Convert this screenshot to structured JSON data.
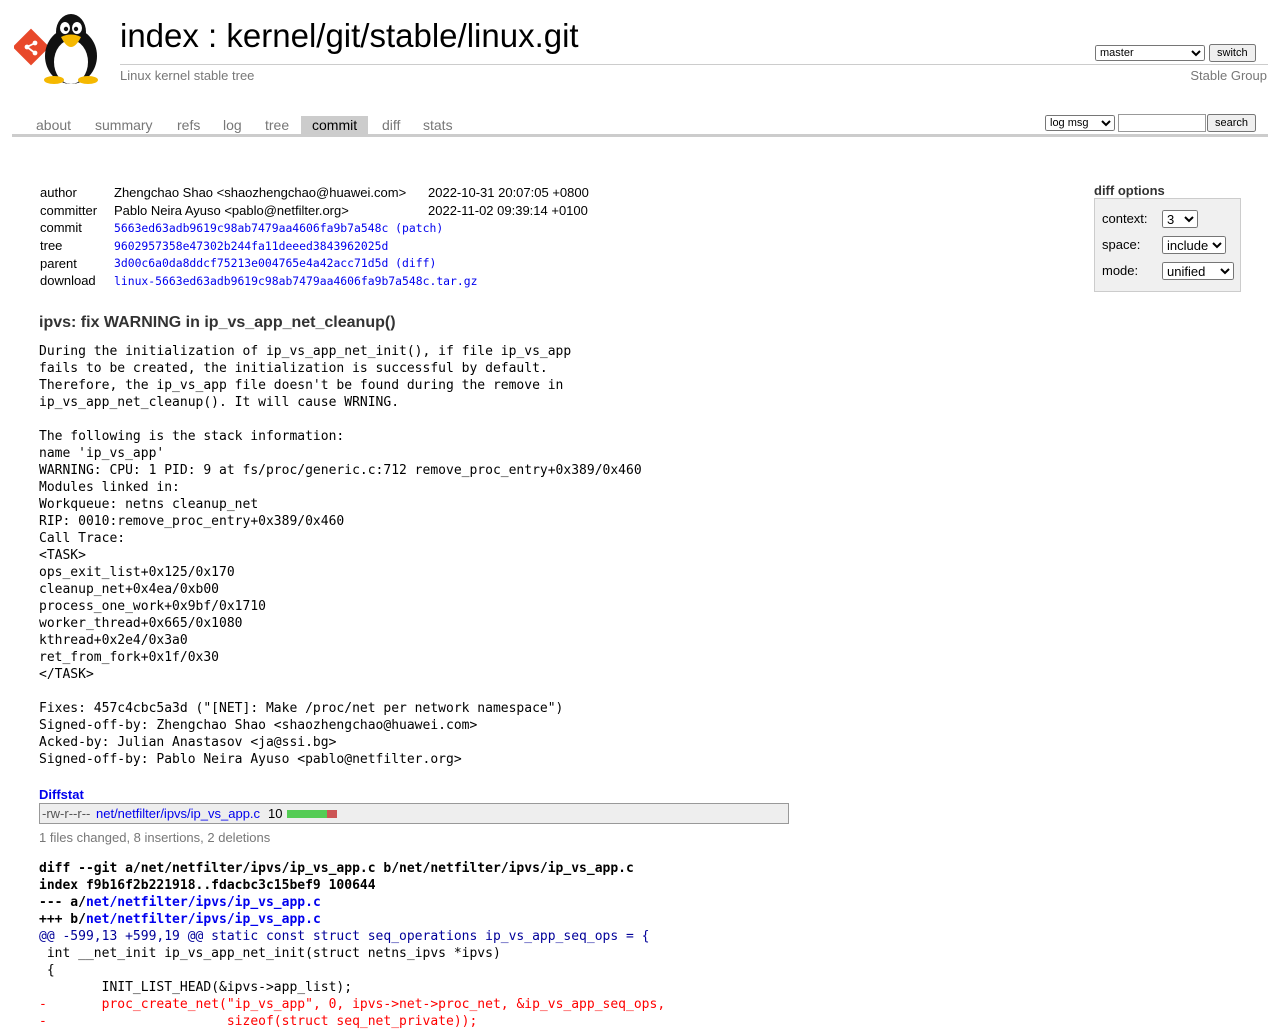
{
  "header": {
    "title_index": "index",
    "title_sep": " : ",
    "title_repo": "kernel/git/stable/linux.git",
    "subtitle": "Linux kernel stable tree",
    "branch": "master",
    "switch_label": "switch",
    "owner": "Stable Group"
  },
  "tabs": [
    {
      "label": "about"
    },
    {
      "label": "summary"
    },
    {
      "label": "refs"
    },
    {
      "label": "log"
    },
    {
      "label": "tree"
    },
    {
      "label": "commit",
      "active": true
    },
    {
      "label": "diff"
    },
    {
      "label": "stats"
    }
  ],
  "search": {
    "mode": "log msg",
    "query": "",
    "button": "search"
  },
  "commit": {
    "author_label": "author",
    "author": "Zhengchao Shao <shaozhengchao@huawei.com>",
    "author_date": "2022-10-31 20:07:05 +0800",
    "committer_label": "committer",
    "committer": "Pablo Neira Ayuso <pablo@netfilter.org>",
    "committer_date": "2022-11-02 09:39:14 +0100",
    "commit_label": "commit",
    "commit_sha": "5663ed63adb9619c98ab7479aa4606fa9b7a548c",
    "patch_link": "(patch)",
    "tree_label": "tree",
    "tree_sha": "9602957358e47302b244fa11deeed3843962025d",
    "parent_label": "parent",
    "parent_sha": "3d00c6a0da8ddcf75213e004765e4a42acc71d5d",
    "diff_link": "(diff)",
    "download_label": "download",
    "download": "linux-5663ed63adb9619c98ab7479aa4606fa9b7a548c.tar.gz",
    "subject": "ipvs: fix WARNING in ip_vs_app_net_cleanup()",
    "message": "During the initialization of ip_vs_app_net_init(), if file ip_vs_app\nfails to be created, the initialization is successful by default.\nTherefore, the ip_vs_app file doesn't be found during the remove in\nip_vs_app_net_cleanup(). It will cause WRNING.\n\nThe following is the stack information:\nname 'ip_vs_app'\nWARNING: CPU: 1 PID: 9 at fs/proc/generic.c:712 remove_proc_entry+0x389/0x460\nModules linked in:\nWorkqueue: netns cleanup_net\nRIP: 0010:remove_proc_entry+0x389/0x460\nCall Trace:\n<TASK>\nops_exit_list+0x125/0x170\ncleanup_net+0x4ea/0xb00\nprocess_one_work+0x9bf/0x1710\nworker_thread+0x665/0x1080\nkthread+0x2e4/0x3a0\nret_from_fork+0x1f/0x30\n</TASK>\n\nFixes: 457c4cbc5a3d (\"[NET]: Make /proc/net per network namespace\")\nSigned-off-by: Zhengchao Shao <shaozhengchao@huawei.com>\nAcked-by: Julian Anastasov <ja@ssi.bg>\nSigned-off-by: Pablo Neira Ayuso <pablo@netfilter.org>"
  },
  "diff_options": {
    "title": "diff options",
    "context_label": "context:",
    "context": "3",
    "space_label": "space:",
    "space": "include",
    "mode_label": "mode:",
    "mode": "unified"
  },
  "diffstat": {
    "heading": "Diffstat",
    "file_mode": "-rw-r--r--",
    "file": "net/netfilter/ipvs/ip_vs_app.c",
    "changes": "10",
    "insertions": 8,
    "deletions": 2,
    "summary": "1 files changed, 8 insertions, 2 deletions"
  },
  "diff": {
    "git_line": "diff --git a/net/netfilter/ipvs/ip_vs_app.c b/net/netfilter/ipvs/ip_vs_app.c",
    "index_line": "index f9b16f2b221918..fdacbc3c15bef9 100644",
    "minus_prefix": "--- a/",
    "plus_prefix": "+++ b/",
    "path": "net/netfilter/ipvs/ip_vs_app.c",
    "hunk": "@@ -599,13 +599,19 @@ static const struct seq_operations ip_vs_app_seq_ops = {",
    "lines": [
      {
        "type": "ctx",
        "text": " int __net_init ip_vs_app_net_init(struct netns_ipvs *ipvs)"
      },
      {
        "type": "ctx",
        "text": " {"
      },
      {
        "type": "ctx",
        "text": " \tINIT_LIST_HEAD(&ipvs->app_list);"
      },
      {
        "type": "del",
        "text": "-\tproc_create_net(\"ip_vs_app\", 0, ipvs->net->proc_net, &ip_vs_app_seq_ops,"
      },
      {
        "type": "del",
        "text": "-\t\t\tsizeof(struct seq_net_private));"
      }
    ]
  },
  "colors": {
    "link": "#0000ee",
    "insert_bar": "#55cc55",
    "delete_bar": "#cc5555",
    "hunk": "#000099",
    "deleted": "#ff0000"
  }
}
